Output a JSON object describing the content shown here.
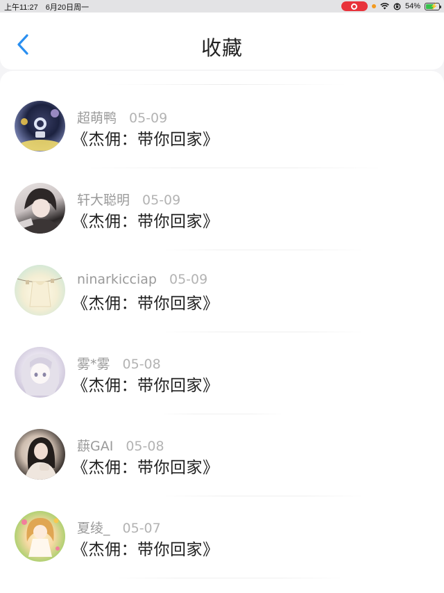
{
  "status_bar": {
    "time": "上午11:27",
    "date": "6月20日周一",
    "battery": "54%",
    "battery_level": 0.54
  },
  "nav": {
    "title": "收藏",
    "back_icon": "chevron-left-icon",
    "accent_color": "#2a8ff0"
  },
  "favorites": [
    {
      "author": "超萌鸭",
      "date": "05-09",
      "title": "《杰佣：带你回家》"
    },
    {
      "author": "轩大聪明",
      "date": "05-09",
      "title": "《杰佣：带你回家》"
    },
    {
      "author": "ninarkicciap",
      "date": "05-09",
      "title": "《杰佣：带你回家》"
    },
    {
      "author": "雾*雾",
      "date": "05-08",
      "title": "《杰佣：带你回家》"
    },
    {
      "author": "蕻GAI",
      "date": "05-08",
      "title": "《杰佣：带你回家》"
    },
    {
      "author": "夏绫_",
      "date": "05-07",
      "title": "《杰佣：带你回家》"
    }
  ]
}
